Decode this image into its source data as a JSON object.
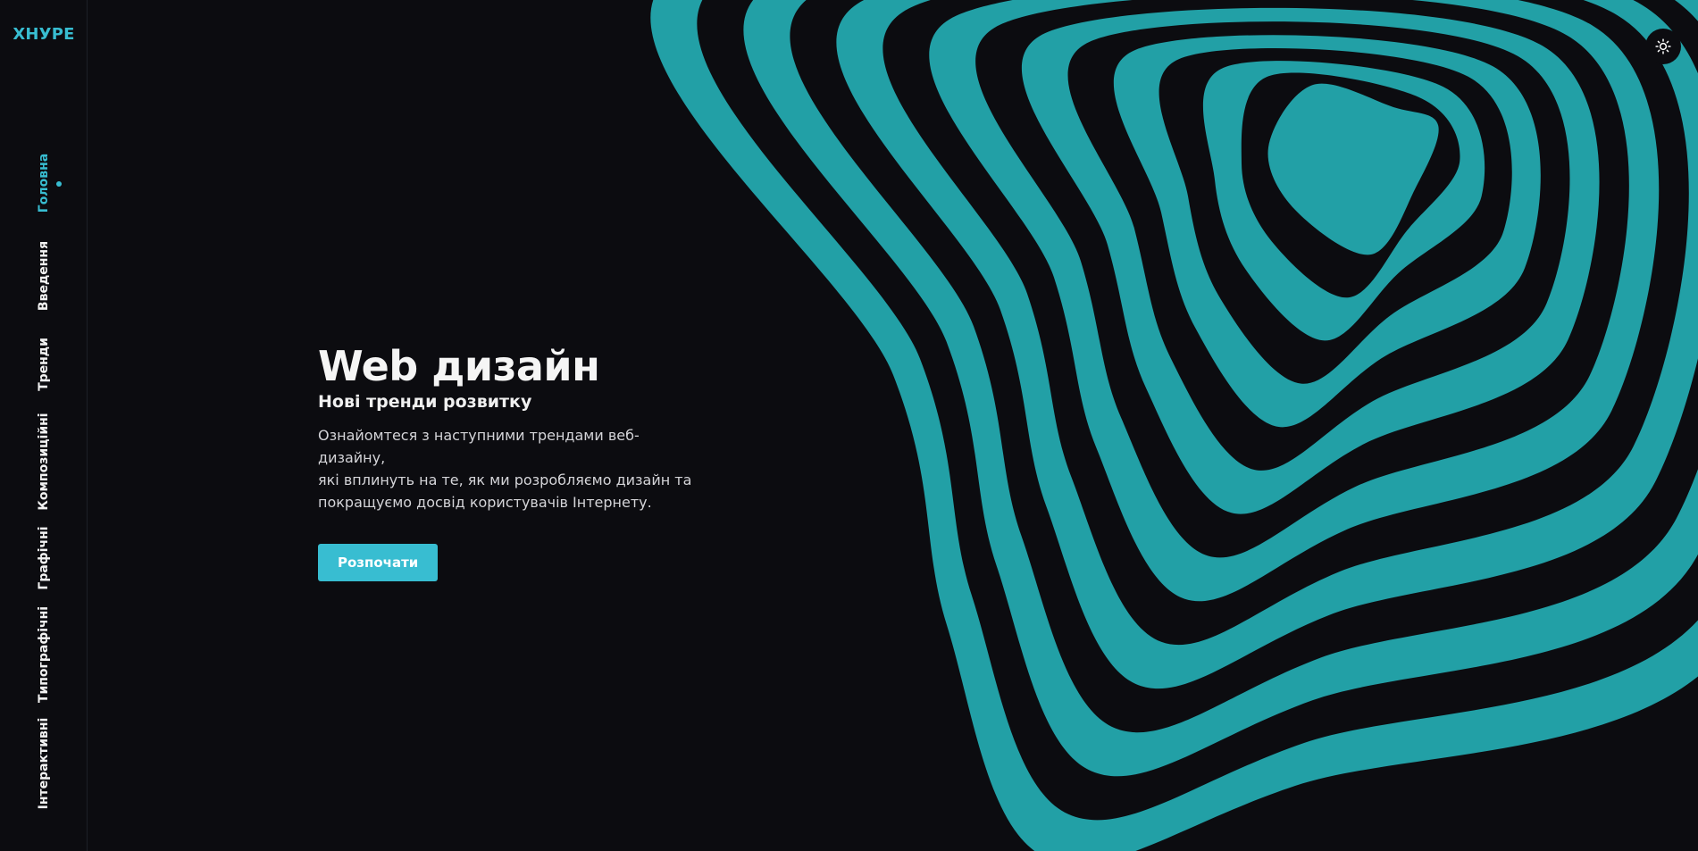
{
  "brand": {
    "logo": "ХНУРЕ",
    "accent_color": "#38bdd1",
    "background_color": "#0c0c10",
    "pattern_color": "#22a0a6"
  },
  "sidebar": {
    "items": [
      {
        "label": "Головна",
        "active": true
      },
      {
        "label": "Введення",
        "active": false
      },
      {
        "label": "Тренди",
        "active": false
      },
      {
        "label": "Композиційні",
        "active": false
      },
      {
        "label": "Графічні",
        "active": false
      },
      {
        "label": "Типографічні",
        "active": false
      },
      {
        "label": "Інтерактивні",
        "active": false
      }
    ]
  },
  "hero": {
    "title": "Web дизайн",
    "subtitle": "Нові тренди розвитку",
    "description_lines": [
      "Ознайомтеся з наступними трендами веб-дизайну,",
      "які вплинуть на те, як ми розробляємо дизайн та",
      "покращуємо досвід користувачів Інтернету."
    ],
    "cta_label": "Розпочати"
  },
  "theme_toggle": {
    "icon": "sun-icon"
  }
}
